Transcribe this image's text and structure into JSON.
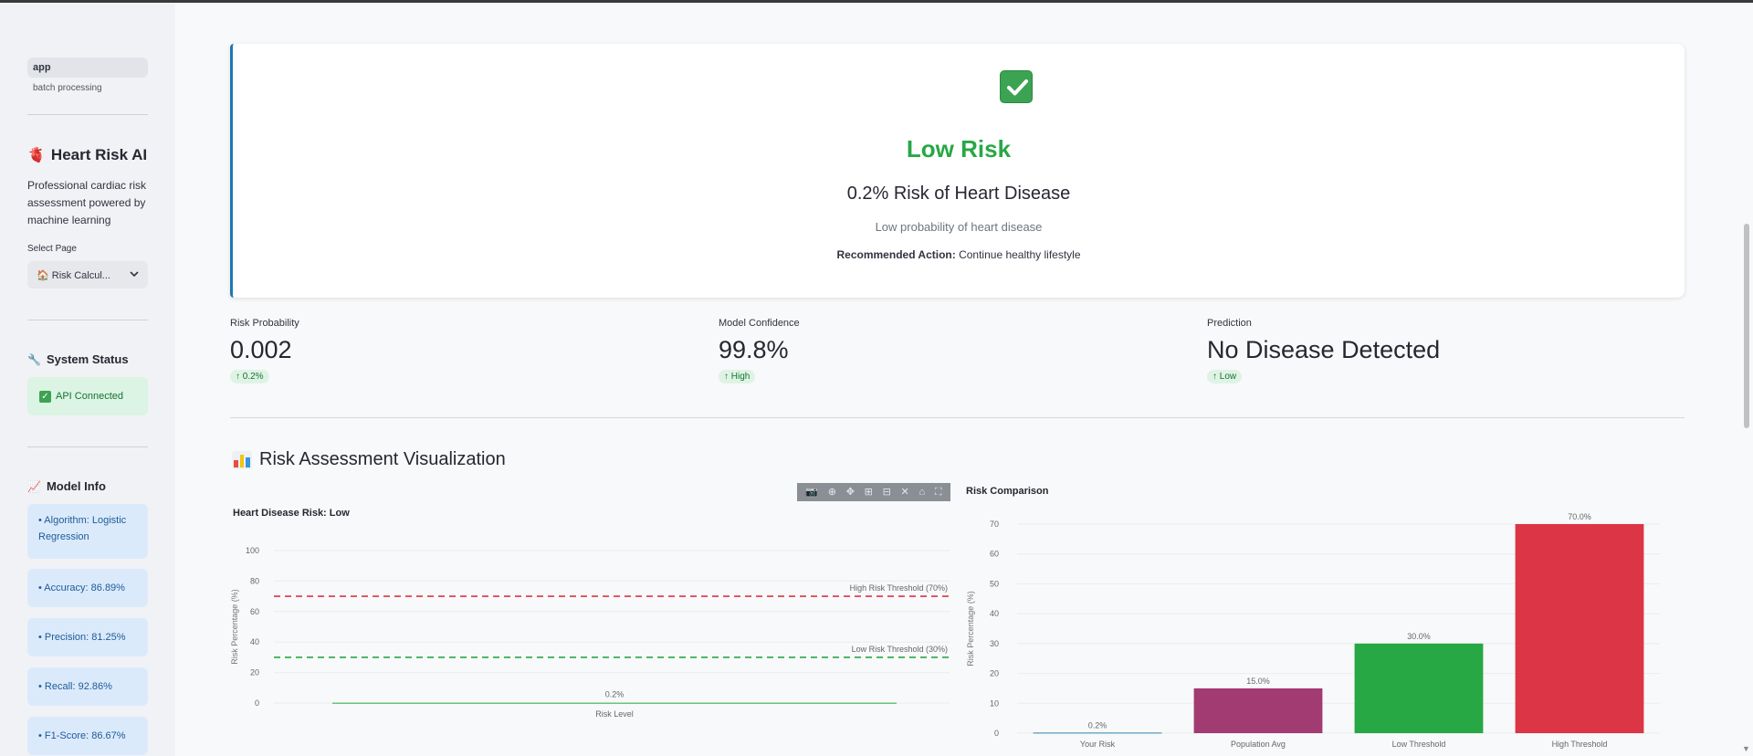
{
  "sidebar": {
    "nav_active": "app",
    "nav_sub": "batch processing",
    "title_icon": "anatomical-heart-icon",
    "title": "Heart Risk AI",
    "description": "Professional cardiac risk assessment powered by machine learning",
    "select_label": "Select Page",
    "select_value": "🏠 Risk Calcul...",
    "status_heading": "System Status",
    "api_status": "API Connected",
    "model_heading": "Model Info",
    "model_info": [
      "• Algorithm: Logistic Regression",
      "• Accuracy: 86.89%",
      "• Precision: 81.25%",
      "• Recall: 92.86%",
      "• F1-Score: 86.67%"
    ]
  },
  "result": {
    "icon": "check-mark-icon",
    "level": "Low Risk",
    "percentage_text": "0.2% Risk of Heart Disease",
    "description": "Low probability of heart disease",
    "action_label": "Recommended Action:",
    "action_text": " Continue healthy lifestyle"
  },
  "metrics": [
    {
      "label": "Risk Probability",
      "value": "0.002",
      "delta": "0.2%"
    },
    {
      "label": "Model Confidence",
      "value": "99.8%",
      "delta": "High"
    },
    {
      "label": "Prediction",
      "value": "No Disease Detected",
      "delta": "Low"
    }
  ],
  "viz": {
    "title": "Risk Assessment Visualization"
  },
  "colors": {
    "low": "#28a745",
    "high": "#dc3545",
    "population": "#a23b72",
    "your_risk": "#2e86ab"
  },
  "chart_data": [
    {
      "type": "bar",
      "title": "Heart Disease Risk: Low",
      "xlabel": "Risk Level",
      "ylabel": "Risk Percentage (%)",
      "ylim": [
        0,
        100
      ],
      "yticks": [
        0,
        20,
        40,
        60,
        80,
        100
      ],
      "categories": [
        "Risk Level"
      ],
      "values": [
        0.2
      ],
      "value_labels": [
        "0.2%"
      ],
      "thresholds": [
        {
          "name": "High Risk Threshold (70%)",
          "value": 70,
          "color": "#dc3545"
        },
        {
          "name": "Low Risk Threshold (30%)",
          "value": 30,
          "color": "#28a745"
        }
      ],
      "grid": true
    },
    {
      "type": "bar",
      "title": "Risk Comparison",
      "xlabel": "",
      "ylabel": "Risk Percentage (%)",
      "ylim": [
        0,
        70
      ],
      "yticks": [
        0,
        10,
        20,
        30,
        40,
        50,
        60,
        70
      ],
      "categories": [
        "Your Risk",
        "Population Avg",
        "Low Threshold",
        "High Threshold"
      ],
      "values": [
        0.2,
        15,
        30,
        70
      ],
      "value_labels": [
        "0.2%",
        "15.0%",
        "30.0%",
        "70.0%"
      ],
      "bar_colors": [
        "#2e86ab",
        "#a23b72",
        "#28a745",
        "#dc3545"
      ],
      "grid": true
    }
  ]
}
